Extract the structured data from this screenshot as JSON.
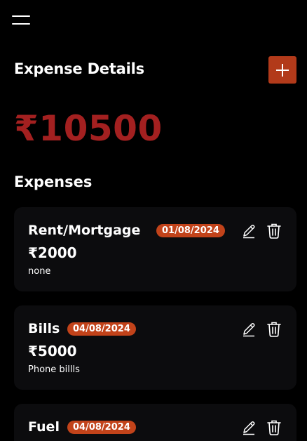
{
  "header": {
    "title": "Expense Details",
    "total": "₹10500",
    "section_title": "Expenses"
  },
  "icons": {
    "menu": "hamburger-icon",
    "add": "plus-icon",
    "edit": "pencil-icon",
    "delete": "trash-icon"
  },
  "colors": {
    "background": "#000000",
    "card": "#0c0c0e",
    "accent": "#b23a1a",
    "badge": "#c2431a",
    "total": "#a32020"
  },
  "expenses": [
    {
      "name": "Rent/Mortgage",
      "date": "01/08/2024",
      "amount": "₹2000",
      "note": "none"
    },
    {
      "name": "Bills",
      "date": "04/08/2024",
      "amount": "₹5000",
      "note": "Phone billls"
    },
    {
      "name": "Fuel",
      "date": "04/08/2024",
      "amount": "",
      "note": ""
    }
  ]
}
